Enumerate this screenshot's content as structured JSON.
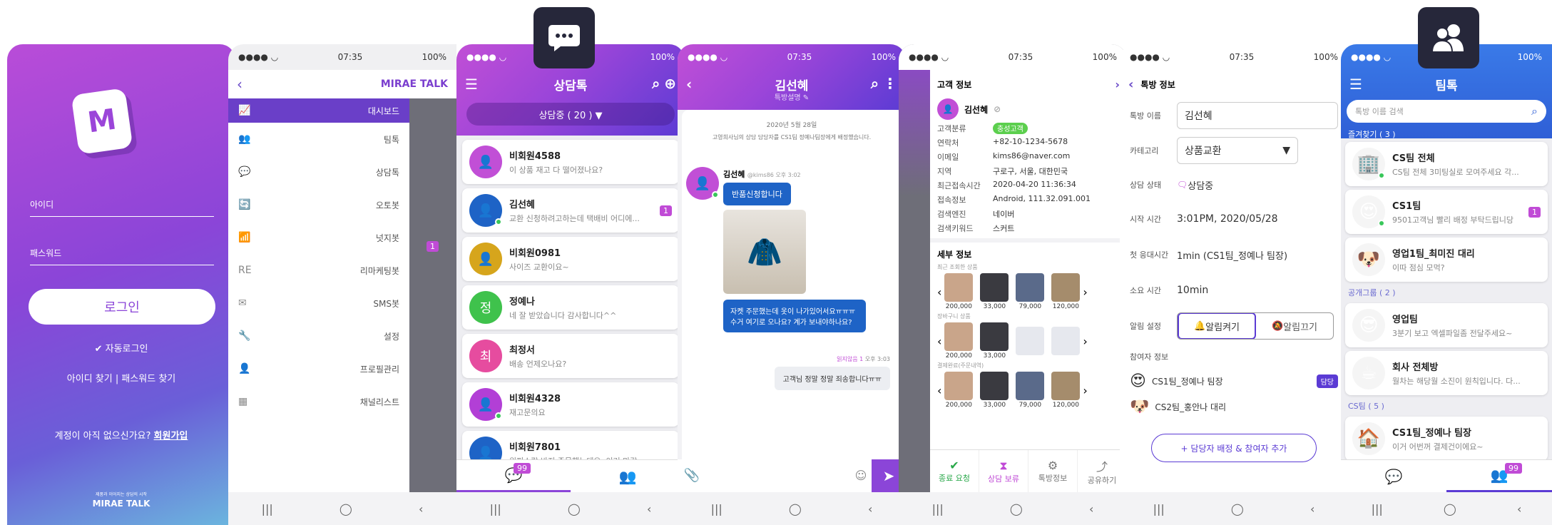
{
  "status": {
    "time": "07:35",
    "battery": "100%"
  },
  "login": {
    "id_label": "아이디",
    "pw_label": "패스워드",
    "login_button": "로그인",
    "auto_login": "자동로그인",
    "find_id": "아이디 찾기",
    "sep": "|",
    "find_pw": "패스워드 찾기",
    "no_account": "계정이 아직 없으신가요?",
    "signup": "회원가입",
    "tagline": "제품과 이어지는 상담의 시작",
    "brand": "MIRAE TALK"
  },
  "menu": {
    "brand": "MIRAE TALK",
    "items": [
      {
        "icon": "chart-icon",
        "label": "대시보드"
      },
      {
        "icon": "team-icon",
        "label": "팀톡"
      },
      {
        "icon": "chat-icon",
        "label": "상담톡"
      },
      {
        "icon": "auto-icon",
        "label": "오토봇"
      },
      {
        "icon": "nudge-icon",
        "label": "넛지봇"
      },
      {
        "icon": "remarketing-icon",
        "label": "리마케팅봇"
      },
      {
        "icon": "mail-icon",
        "label": "SMS봇"
      },
      {
        "icon": "settings-icon",
        "label": "설정"
      },
      {
        "icon": "profile-icon",
        "label": "프로필관리"
      },
      {
        "icon": "channel-icon",
        "label": "채널리스트"
      }
    ],
    "badge": "1"
  },
  "consult": {
    "title": "상담톡",
    "filter": "상담중 ( 20 ) ▼",
    "tab_badge": "99",
    "items": [
      {
        "name": "비회원4588",
        "msg": "이 상품 재고 다 떨어졌나요?",
        "color": "#c14fd6",
        "letter": "",
        "badge": ""
      },
      {
        "name": "김선혜",
        "msg": "교환 신청하려고하는데 택배비 어디에...",
        "color": "#1e63c6",
        "letter": "",
        "badge": "1"
      },
      {
        "name": "비회원0981",
        "msg": "사이즈 교환이요~",
        "color": "#d6a51c",
        "letter": "",
        "badge": ""
      },
      {
        "name": "정예나",
        "msg": "네 잘 받았습니다 감사합니다^^",
        "color": "#3fc24c",
        "letter": "정",
        "badge": ""
      },
      {
        "name": "최정서",
        "msg": "배송 언제오나요?",
        "color": "#e64c9f",
        "letter": "최",
        "badge": ""
      },
      {
        "name": "비회원4328",
        "msg": "재고문의요",
        "color": "#b23fd6",
        "letter": "",
        "badge": ""
      },
      {
        "name": "비회원7801",
        "msg": "원피스랑 바지 주문했는데요, 이거 마감...",
        "color": "#1e63c6",
        "letter": "",
        "badge": ""
      }
    ]
  },
  "chat": {
    "title": "김선혜",
    "subtitle": "특방설명",
    "date": "2020년 5월 28일",
    "system": "고영희사님의 상담 담당자를 CS1팀 정예나팀장에게 배정했습니다.",
    "sender": "김선혜",
    "sender_id": "@kims86 오후 3:02",
    "bubble1": "반품신청합니다",
    "bubble2": "자켓 주문했는데 옷이 나가있어서요ㅠㅠㅠ 수거 여기로 오나요? 계가 보내야하나요?",
    "read": "읽지않음 1",
    "time2": "오후 3:03",
    "reply": "고객님 정말 정말 죄송합니다ㅠㅠ"
  },
  "customer": {
    "title": "고객 정보",
    "name": "김선혜",
    "fields": [
      {
        "k": "고객분류",
        "v": "충성고객"
      },
      {
        "k": "연락처",
        "v": "+82-10-1234-5678"
      },
      {
        "k": "이메일",
        "v": "kims86@naver.com"
      },
      {
        "k": "지역",
        "v": "구로구, 서울, 대한민국"
      },
      {
        "k": "최근접속시간",
        "v": "2020-04-20 11:36:34"
      },
      {
        "k": "접속정보",
        "v": "Android, 111.32.091.001"
      },
      {
        "k": "검색엔진",
        "v": "네이버"
      },
      {
        "k": "검색키워드",
        "v": "스커트"
      }
    ],
    "detail_title": "세부 정보",
    "recent_label": "최근 조회한 상품",
    "recent_prices": [
      "200,000",
      "33,000",
      "79,000",
      "120,000"
    ],
    "cart_label": "장바구니 상품",
    "cart_prices": [
      "200,000",
      "33,000"
    ],
    "order_label": "결제완료(주문내역)",
    "order_prices": [
      "200,000",
      "33,000",
      "79,000",
      "120,000"
    ],
    "actions": [
      "종료 요청",
      "상담 보류",
      "톡방정보",
      "공유하기"
    ]
  },
  "room": {
    "title": "톡방 정보",
    "name_label": "톡방 이름",
    "name_value": "김선혜",
    "cat_label": "카테고리",
    "cat_value": "상품교환",
    "state_label": "상담 상태",
    "state_value": "상담중",
    "start_label": "시작 시간",
    "start_value": "3:01PM, 2020/05/28",
    "first_label": "첫 응대시간",
    "first_value": "1min (CS1팀_정예나 팀장)",
    "dur_label": "소요 시간",
    "dur_value": "10min",
    "alarm_label": "알림 설정",
    "alarm_on": "알림켜기",
    "alarm_off": "알림끄기",
    "participants_label": "참여자 정보",
    "p1": "CS1팀_정예나 팀장",
    "p1_badge": "담당",
    "p2": "CS2팀_홍안나 대리",
    "add_button": "+ 담당자 배정 & 참여자 추가"
  },
  "team": {
    "title": "팀톡",
    "search_placeholder": "톡방 이름 검색",
    "fav": "즐겨찾기 ( 3 )",
    "public": "공개그룹 ( 2 )",
    "cs": "CS팀 ( 5 )",
    "tab_badge": "99",
    "items": [
      {
        "name": "CS팀 전체",
        "msg": "CS팀 전체 3미팅실로 모여주세요 각...",
        "badge": "",
        "color": "#888"
      },
      {
        "name": "CS1팀",
        "msg": "9501고객님 빨리 배정 부탁드립니당",
        "badge": "1",
        "color": "#f4c21a"
      },
      {
        "name": "영업1팀_최미진 대리",
        "msg": "이따 점심 모먹?",
        "badge": "",
        "color": "#c99a6a"
      },
      {
        "name": "영업팀",
        "msg": "3분기 보고 엑셀파일좀 전달주세요~",
        "badge": "",
        "color": "#f4c21a"
      },
      {
        "name": "회사 전체방",
        "msg": "월차는 해당월 소진이 원칙입니다. 다...",
        "badge": "",
        "color": "#6b8bb0"
      },
      {
        "name": "CS1팀_정예나 팀장",
        "msg": "이거 어번꺼 결제건이에요~",
        "badge": "",
        "color": "#999"
      }
    ]
  }
}
